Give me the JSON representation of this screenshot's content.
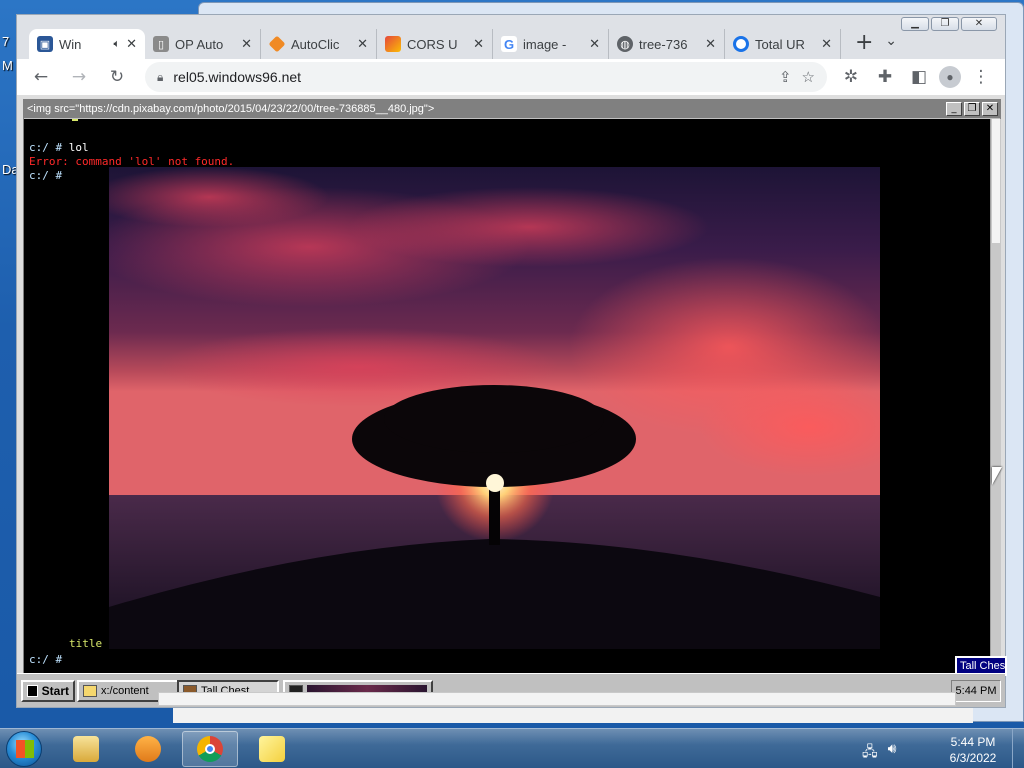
{
  "desktop": {
    "label_m": "M",
    "label_d": "Da",
    "label_7": "7"
  },
  "chrome": {
    "tabs": [
      {
        "title": "Win",
        "fav_color": "#2b5797",
        "active": true
      },
      {
        "title": "OP Auto",
        "fav_color": "#7a7a7a"
      },
      {
        "title": "AutoClic",
        "fav_color": "#f08a24"
      },
      {
        "title": "CORS U",
        "fav_color": "#e5473b"
      },
      {
        "title": "image -",
        "fav_color": "#4285f4"
      },
      {
        "title": "tree-736",
        "fav_color": "#5f6368"
      },
      {
        "title": "Total UR",
        "fav_color": "#1a73e8"
      }
    ],
    "new_tab": "+",
    "url": "rel05.windows96.net"
  },
  "w96": {
    "window_title": "<img src=\"https://cdn.pixabay.com/photo/2015/04/23/22/00/tree-736885__480.jpg\">",
    "terminal": {
      "prompt1": "c:/ #",
      "cmd1": "lol",
      "error": "Error: command 'lol' not found.",
      "prompt2": "c:/ #",
      "title_text": "title",
      "prompt3": "c:/ #"
    },
    "taskbar": {
      "start": "Start",
      "item1": "x:/content",
      "item2": "Tall Chest",
      "clock": "5:44 PM",
      "tooltip": "Tall Chest"
    }
  },
  "win7": {
    "time": "5:44 PM",
    "date": "6/3/2022"
  }
}
